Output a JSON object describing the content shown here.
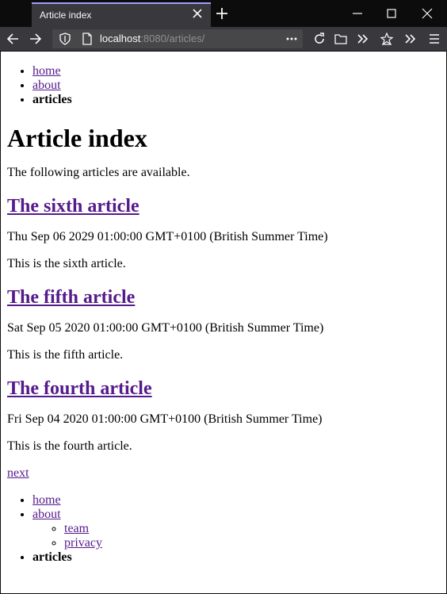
{
  "browser": {
    "tab_title": "Article index",
    "url_host": "localhost",
    "url_path": ":8080/articles/"
  },
  "nav_top": [
    {
      "label": "home",
      "link": true
    },
    {
      "label": "about",
      "link": true
    },
    {
      "label": "articles",
      "link": false
    }
  ],
  "page": {
    "title": "Article index",
    "intro": "The following articles are available."
  },
  "articles": [
    {
      "title": "The sixth article",
      "date": "Thu Sep 06 2029 01:00:00 GMT+0100 (British Summer Time)",
      "summary": "This is the sixth article."
    },
    {
      "title": "The fifth article",
      "date": "Sat Sep 05 2020 01:00:00 GMT+0100 (British Summer Time)",
      "summary": "This is the fifth article."
    },
    {
      "title": "The fourth article",
      "date": "Fri Sep 04 2020 01:00:00 GMT+0100 (British Summer Time)",
      "summary": "This is the fourth article."
    }
  ],
  "pagination": {
    "next_label": "next"
  },
  "nav_bottom": {
    "home": "home",
    "about": "about",
    "about_children": [
      "team",
      "privacy"
    ],
    "articles": "articles"
  },
  "icons": {
    "back": "back-arrow-icon",
    "forward": "forward-arrow-icon",
    "reload": "reload-icon"
  },
  "colors": {
    "link_visited": "#551a8b",
    "tab_accent": "#a0a0ff",
    "toolbar_bg": "#38383d",
    "titlebar_bg": "#0c0c0d"
  }
}
